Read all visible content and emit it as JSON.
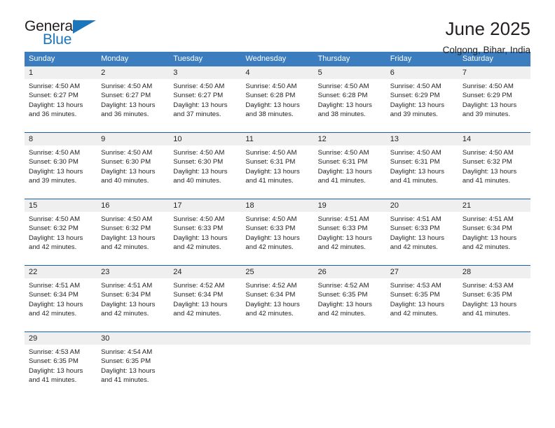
{
  "logo": {
    "word_one": "General",
    "word_two": "Blue",
    "triangle_icon": "blue-triangle-icon"
  },
  "header": {
    "month_title": "June 2025",
    "location": "Colgong, Bihar, India"
  },
  "colors": {
    "header_blue": "#3b7dbf",
    "rule_blue": "#1b5fa3",
    "logo_blue": "#1b76bc",
    "daynum_band": "#efefef",
    "text": "#231f20"
  },
  "calendar": {
    "weekday_headers": [
      "Sunday",
      "Monday",
      "Tuesday",
      "Wednesday",
      "Thursday",
      "Friday",
      "Saturday"
    ],
    "weeks": [
      {
        "days": [
          {
            "num": "1",
            "sunrise": "Sunrise: 4:50 AM",
            "sunset": "Sunset: 6:27 PM",
            "daylight": "Daylight: 13 hours and 36 minutes."
          },
          {
            "num": "2",
            "sunrise": "Sunrise: 4:50 AM",
            "sunset": "Sunset: 6:27 PM",
            "daylight": "Daylight: 13 hours and 36 minutes."
          },
          {
            "num": "3",
            "sunrise": "Sunrise: 4:50 AM",
            "sunset": "Sunset: 6:27 PM",
            "daylight": "Daylight: 13 hours and 37 minutes."
          },
          {
            "num": "4",
            "sunrise": "Sunrise: 4:50 AM",
            "sunset": "Sunset: 6:28 PM",
            "daylight": "Daylight: 13 hours and 38 minutes."
          },
          {
            "num": "5",
            "sunrise": "Sunrise: 4:50 AM",
            "sunset": "Sunset: 6:28 PM",
            "daylight": "Daylight: 13 hours and 38 minutes."
          },
          {
            "num": "6",
            "sunrise": "Sunrise: 4:50 AM",
            "sunset": "Sunset: 6:29 PM",
            "daylight": "Daylight: 13 hours and 39 minutes."
          },
          {
            "num": "7",
            "sunrise": "Sunrise: 4:50 AM",
            "sunset": "Sunset: 6:29 PM",
            "daylight": "Daylight: 13 hours and 39 minutes."
          }
        ]
      },
      {
        "days": [
          {
            "num": "8",
            "sunrise": "Sunrise: 4:50 AM",
            "sunset": "Sunset: 6:30 PM",
            "daylight": "Daylight: 13 hours and 39 minutes."
          },
          {
            "num": "9",
            "sunrise": "Sunrise: 4:50 AM",
            "sunset": "Sunset: 6:30 PM",
            "daylight": "Daylight: 13 hours and 40 minutes."
          },
          {
            "num": "10",
            "sunrise": "Sunrise: 4:50 AM",
            "sunset": "Sunset: 6:30 PM",
            "daylight": "Daylight: 13 hours and 40 minutes."
          },
          {
            "num": "11",
            "sunrise": "Sunrise: 4:50 AM",
            "sunset": "Sunset: 6:31 PM",
            "daylight": "Daylight: 13 hours and 41 minutes."
          },
          {
            "num": "12",
            "sunrise": "Sunrise: 4:50 AM",
            "sunset": "Sunset: 6:31 PM",
            "daylight": "Daylight: 13 hours and 41 minutes."
          },
          {
            "num": "13",
            "sunrise": "Sunrise: 4:50 AM",
            "sunset": "Sunset: 6:31 PM",
            "daylight": "Daylight: 13 hours and 41 minutes."
          },
          {
            "num": "14",
            "sunrise": "Sunrise: 4:50 AM",
            "sunset": "Sunset: 6:32 PM",
            "daylight": "Daylight: 13 hours and 41 minutes."
          }
        ]
      },
      {
        "days": [
          {
            "num": "15",
            "sunrise": "Sunrise: 4:50 AM",
            "sunset": "Sunset: 6:32 PM",
            "daylight": "Daylight: 13 hours and 42 minutes."
          },
          {
            "num": "16",
            "sunrise": "Sunrise: 4:50 AM",
            "sunset": "Sunset: 6:32 PM",
            "daylight": "Daylight: 13 hours and 42 minutes."
          },
          {
            "num": "17",
            "sunrise": "Sunrise: 4:50 AM",
            "sunset": "Sunset: 6:33 PM",
            "daylight": "Daylight: 13 hours and 42 minutes."
          },
          {
            "num": "18",
            "sunrise": "Sunrise: 4:50 AM",
            "sunset": "Sunset: 6:33 PM",
            "daylight": "Daylight: 13 hours and 42 minutes."
          },
          {
            "num": "19",
            "sunrise": "Sunrise: 4:51 AM",
            "sunset": "Sunset: 6:33 PM",
            "daylight": "Daylight: 13 hours and 42 minutes."
          },
          {
            "num": "20",
            "sunrise": "Sunrise: 4:51 AM",
            "sunset": "Sunset: 6:33 PM",
            "daylight": "Daylight: 13 hours and 42 minutes."
          },
          {
            "num": "21",
            "sunrise": "Sunrise: 4:51 AM",
            "sunset": "Sunset: 6:34 PM",
            "daylight": "Daylight: 13 hours and 42 minutes."
          }
        ]
      },
      {
        "days": [
          {
            "num": "22",
            "sunrise": "Sunrise: 4:51 AM",
            "sunset": "Sunset: 6:34 PM",
            "daylight": "Daylight: 13 hours and 42 minutes."
          },
          {
            "num": "23",
            "sunrise": "Sunrise: 4:51 AM",
            "sunset": "Sunset: 6:34 PM",
            "daylight": "Daylight: 13 hours and 42 minutes."
          },
          {
            "num": "24",
            "sunrise": "Sunrise: 4:52 AM",
            "sunset": "Sunset: 6:34 PM",
            "daylight": "Daylight: 13 hours and 42 minutes."
          },
          {
            "num": "25",
            "sunrise": "Sunrise: 4:52 AM",
            "sunset": "Sunset: 6:34 PM",
            "daylight": "Daylight: 13 hours and 42 minutes."
          },
          {
            "num": "26",
            "sunrise": "Sunrise: 4:52 AM",
            "sunset": "Sunset: 6:35 PM",
            "daylight": "Daylight: 13 hours and 42 minutes."
          },
          {
            "num": "27",
            "sunrise": "Sunrise: 4:53 AM",
            "sunset": "Sunset: 6:35 PM",
            "daylight": "Daylight: 13 hours and 42 minutes."
          },
          {
            "num": "28",
            "sunrise": "Sunrise: 4:53 AM",
            "sunset": "Sunset: 6:35 PM",
            "daylight": "Daylight: 13 hours and 41 minutes."
          }
        ]
      },
      {
        "days": [
          {
            "num": "29",
            "sunrise": "Sunrise: 4:53 AM",
            "sunset": "Sunset: 6:35 PM",
            "daylight": "Daylight: 13 hours and 41 minutes."
          },
          {
            "num": "30",
            "sunrise": "Sunrise: 4:54 AM",
            "sunset": "Sunset: 6:35 PM",
            "daylight": "Daylight: 13 hours and 41 minutes."
          },
          {
            "num": "",
            "sunrise": "",
            "sunset": "",
            "daylight": ""
          },
          {
            "num": "",
            "sunrise": "",
            "sunset": "",
            "daylight": ""
          },
          {
            "num": "",
            "sunrise": "",
            "sunset": "",
            "daylight": ""
          },
          {
            "num": "",
            "sunrise": "",
            "sunset": "",
            "daylight": ""
          },
          {
            "num": "",
            "sunrise": "",
            "sunset": "",
            "daylight": ""
          }
        ]
      }
    ]
  }
}
